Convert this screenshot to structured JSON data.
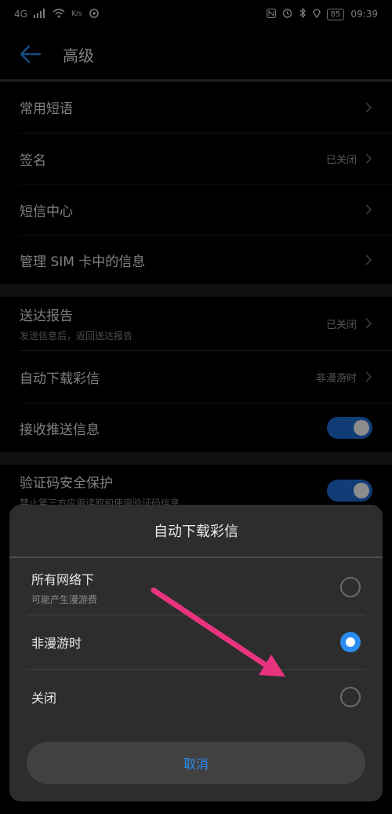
{
  "status_bar": {
    "left": [
      "4G",
      "K/s"
    ],
    "time": "09:39",
    "battery": "85"
  },
  "app_bar": {
    "title": "高级"
  },
  "settings": {
    "items": [
      {
        "label": "常用短语"
      },
      {
        "label": "签名",
        "value": "已关闭"
      },
      {
        "label": "短信中心"
      },
      {
        "label": "管理 SIM 卡中的信息"
      },
      {
        "label": "送达报告",
        "sub": "发送信息后，返回送达报告",
        "value": "已关闭"
      },
      {
        "label": "自动下载彩信",
        "value": "非漫游时"
      },
      {
        "label": "接收推送信息",
        "toggle": "on"
      },
      {
        "label": "验证码安全保护",
        "sub": "禁止第三方应用读取和使用验证码信息",
        "toggle": "on"
      }
    ]
  },
  "dialog": {
    "title": "自动下载彩信",
    "options": [
      {
        "label": "所有网络下",
        "sub": "可能产生漫游费",
        "selected": false
      },
      {
        "label": "非漫游时",
        "selected": true
      },
      {
        "label": "关闭",
        "selected": false
      }
    ],
    "cancel_label": "取消"
  },
  "colors": {
    "accent": "#2b8cf0",
    "annotation_arrow": "#e8337f"
  }
}
